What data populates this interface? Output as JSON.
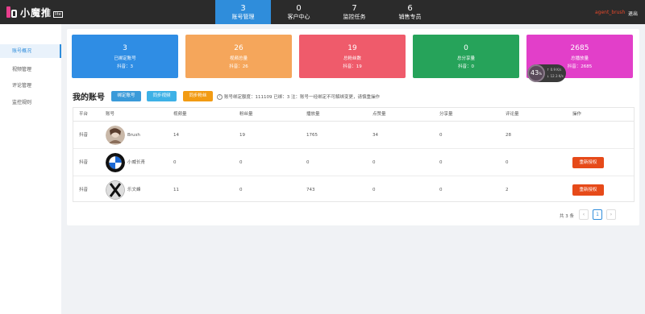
{
  "app": {
    "logo_text": "小魔推",
    "logo_badge": "lite"
  },
  "topnav": [
    {
      "num": "3",
      "label": "账号管理"
    },
    {
      "num": "0",
      "label": "客户中心"
    },
    {
      "num": "7",
      "label": "监控任务"
    },
    {
      "num": "6",
      "label": "销售专员"
    }
  ],
  "header": {
    "user": "agent_brush",
    "logout": "退出"
  },
  "sidebar": {
    "items": [
      {
        "label": "账号概况"
      },
      {
        "label": "视频管理"
      },
      {
        "label": "评论管理"
      },
      {
        "label": "监控规则"
      }
    ]
  },
  "cards": [
    {
      "value": "3",
      "title": "已绑定账号",
      "sub": "抖音：3",
      "color": "#2f8de4"
    },
    {
      "value": "26",
      "title": "视频总量",
      "sub": "抖音：26",
      "color": "#f5a65b"
    },
    {
      "value": "19",
      "title": "总粉丝数",
      "sub": "抖音：19",
      "color": "#ef5b6b"
    },
    {
      "value": "0",
      "title": "总分享量",
      "sub": "抖音：0",
      "color": "#26a35a"
    },
    {
      "value": "2685",
      "title": "总播放量",
      "sub": "抖音：2685",
      "color": "#e23fc9"
    }
  ],
  "net_widget": {
    "percent": "43",
    "unit": "%",
    "up": "0.9",
    "up_unit": "K/s",
    "down": "12.3",
    "down_unit": "K/s"
  },
  "accounts": {
    "title": "我的账号",
    "buttons": {
      "bind": "绑定账号",
      "sync_video": "同步视频",
      "sync_fans": "同步粉丝"
    },
    "hint": "账号绑定额度：111109 已绑：3 注：账号一经绑定不可解绑变更，请慎重操作",
    "columns": [
      "平台",
      "账号",
      "视频量",
      "粉丝量",
      "播放量",
      "点赞量",
      "分享量",
      "评论量",
      "操作"
    ],
    "rows": [
      {
        "platform": "抖音",
        "name": "Brush",
        "videos": "14",
        "fans": "19",
        "plays": "1765",
        "likes": "34",
        "shares": "0",
        "comments": "28",
        "action": ""
      },
      {
        "platform": "抖音",
        "name": "小威长青",
        "videos": "0",
        "fans": "0",
        "plays": "0",
        "likes": "0",
        "shares": "0",
        "comments": "0",
        "action": "重新授权"
      },
      {
        "platform": "抖音",
        "name": "乐文峰",
        "videos": "11",
        "fans": "0",
        "plays": "743",
        "likes": "0",
        "shares": "0",
        "comments": "2",
        "action": "重新授权"
      }
    ]
  },
  "pagination": {
    "total": "共 3 条",
    "prev": "‹",
    "page": "1",
    "next": "›"
  }
}
